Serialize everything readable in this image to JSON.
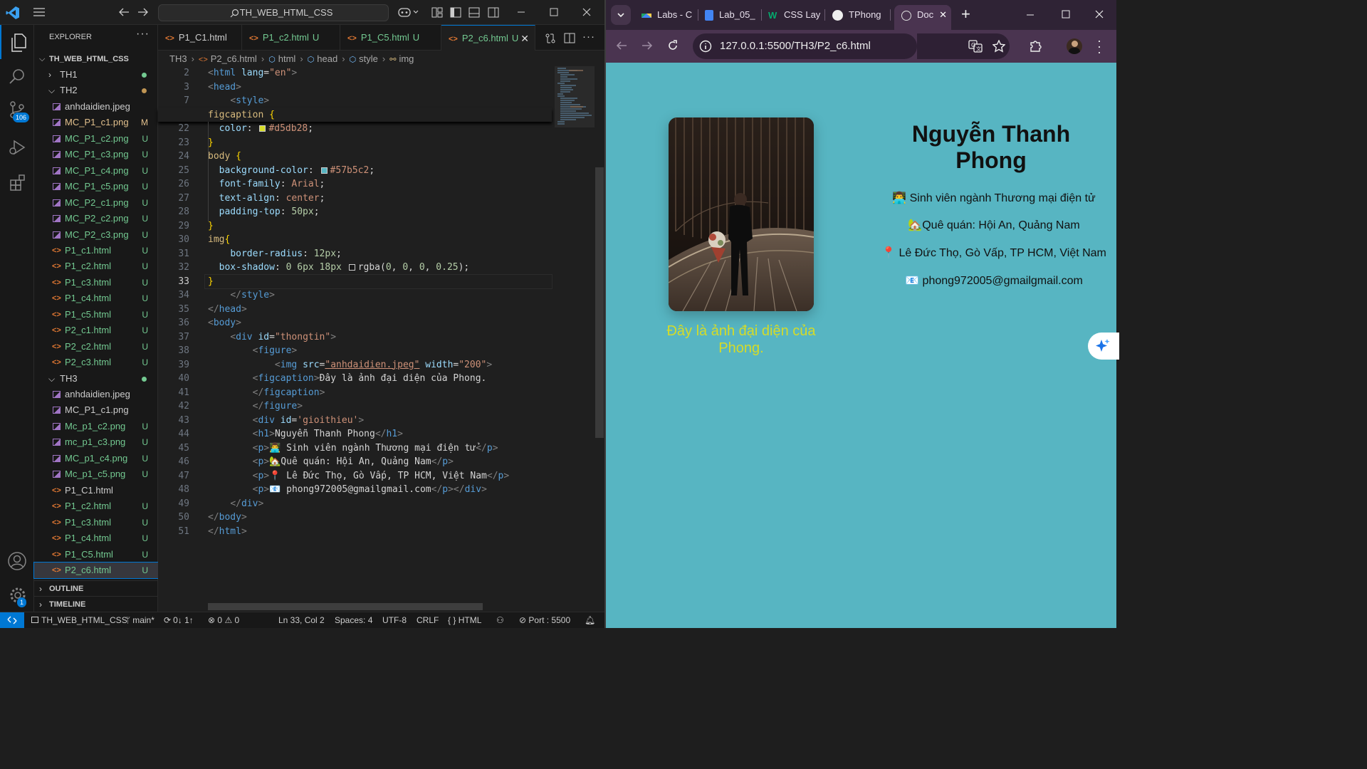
{
  "vscode": {
    "command_center": "TH_WEB_HTML_CSS",
    "scm_badge": "106",
    "settings_badge": "1",
    "explorer": {
      "title": "EXPLORER",
      "root": "TH_WEB_HTML_CSS",
      "items": [
        {
          "label": "TH1",
          "kind": "folder",
          "status": "",
          "dot": "#73c991",
          "open": false
        },
        {
          "label": "TH2",
          "kind": "folder",
          "status": "",
          "dot": "#c09553",
          "open": true
        },
        {
          "label": "anhdaidien.jpeg",
          "kind": "image",
          "status": ""
        },
        {
          "label": "MC_P1_c1.png",
          "kind": "image",
          "status": "M"
        },
        {
          "label": "MC_P1_c2.png",
          "kind": "image",
          "status": "U"
        },
        {
          "label": "MC_P1_c3.png",
          "kind": "image",
          "status": "U"
        },
        {
          "label": "MC_P1_c4.png",
          "kind": "image",
          "status": "U"
        },
        {
          "label": "MC_P1_c5.png",
          "kind": "image",
          "status": "U"
        },
        {
          "label": "MC_P2_c1.png",
          "kind": "image",
          "status": "U"
        },
        {
          "label": "MC_P2_c2.png",
          "kind": "image",
          "status": "U"
        },
        {
          "label": "MC_P2_c3.png",
          "kind": "image",
          "status": "U"
        },
        {
          "label": "P1_c1.html",
          "kind": "html",
          "status": "U"
        },
        {
          "label": "P1_c2.html",
          "kind": "html",
          "status": "U"
        },
        {
          "label": "P1_c3.html",
          "kind": "html",
          "status": "U"
        },
        {
          "label": "P1_c4.html",
          "kind": "html",
          "status": "U"
        },
        {
          "label": "P1_c5.html",
          "kind": "html",
          "status": "U"
        },
        {
          "label": "P2_c1.html",
          "kind": "html",
          "status": "U"
        },
        {
          "label": "P2_c2.html",
          "kind": "html",
          "status": "U"
        },
        {
          "label": "P2_c3.html",
          "kind": "html",
          "status": "U"
        },
        {
          "label": "TH3",
          "kind": "folder",
          "status": "",
          "dot": "#73c991",
          "open": true
        },
        {
          "label": "anhdaidien.jpeg",
          "kind": "image",
          "status": ""
        },
        {
          "label": "MC_P1_c1.png",
          "kind": "image",
          "status": ""
        },
        {
          "label": "Mc_p1_c2.png",
          "kind": "image",
          "status": "U"
        },
        {
          "label": "mc_p1_c3.png",
          "kind": "image",
          "status": "U"
        },
        {
          "label": "MC_p1_c4.png",
          "kind": "image",
          "status": "U"
        },
        {
          "label": "Mc_p1_c5.png",
          "kind": "image",
          "status": "U"
        },
        {
          "label": "P1_C1.html",
          "kind": "html",
          "status": ""
        },
        {
          "label": "P1_c2.html",
          "kind": "html",
          "status": "U"
        },
        {
          "label": "P1_c3.html",
          "kind": "html",
          "status": "U"
        },
        {
          "label": "P1_c4.html",
          "kind": "html",
          "status": "U"
        },
        {
          "label": "P1_C5.html",
          "kind": "html",
          "status": "U"
        },
        {
          "label": "P2_c6.html",
          "kind": "html",
          "status": "U",
          "selected": true
        }
      ],
      "outline": "OUTLINE",
      "timeline": "TIMELINE"
    },
    "tabs": [
      {
        "label": "P1_C1.html",
        "status": "",
        "active": false
      },
      {
        "label": "P1_c2.html",
        "status": "U",
        "active": false
      },
      {
        "label": "P1_C5.html",
        "status": "U",
        "active": false
      },
      {
        "label": "P2_c6.html",
        "status": "U",
        "active": true
      }
    ],
    "breadcrumb": [
      "TH3",
      "P2_c6.html",
      "html",
      "head",
      "style",
      "img"
    ],
    "code_lines": [
      {
        "n": "2",
        "t": [
          [
            "tg",
            "<"
          ],
          [
            "tn",
            "html"
          ],
          [
            "txt",
            " "
          ],
          [
            "at",
            "lang"
          ],
          [
            "txt",
            "="
          ],
          [
            "sv",
            "\"en\""
          ],
          [
            "tg",
            ">"
          ]
        ]
      },
      {
        "n": "3",
        "t": [
          [
            "tg",
            "<"
          ],
          [
            "tn",
            "head"
          ],
          [
            "tg",
            ">"
          ]
        ]
      },
      {
        "n": "7",
        "t": [
          [
            "txt",
            "    "
          ],
          [
            "tg",
            "<"
          ],
          [
            "tn",
            "style"
          ],
          [
            "tg",
            ">"
          ]
        ]
      },
      {
        "n": "19",
        "t": [
          [
            "sel",
            "figcaption"
          ],
          [
            "txt",
            " "
          ],
          [
            "br",
            "{"
          ]
        ],
        "sticky": true
      },
      {
        "n": "22",
        "t": [
          [
            "txt",
            "  "
          ],
          [
            "pr",
            "color"
          ],
          [
            "txt",
            ": "
          ],
          [
            "sw",
            "#d5db28"
          ],
          [
            "pv",
            "#d5db28"
          ],
          [
            "txt",
            ";"
          ]
        ]
      },
      {
        "n": "23",
        "t": [
          [
            "br",
            "}"
          ]
        ]
      },
      {
        "n": "24",
        "t": [
          [
            "sel",
            "body"
          ],
          [
            "txt",
            " "
          ],
          [
            "br",
            "{"
          ]
        ]
      },
      {
        "n": "25",
        "t": [
          [
            "txt",
            "  "
          ],
          [
            "pr",
            "background-color"
          ],
          [
            "txt",
            ": "
          ],
          [
            "sw",
            "#57b5c2"
          ],
          [
            "pv",
            "#57b5c2"
          ],
          [
            "txt",
            ";"
          ]
        ]
      },
      {
        "n": "26",
        "t": [
          [
            "txt",
            "  "
          ],
          [
            "pr",
            "font-family"
          ],
          [
            "txt",
            ": "
          ],
          [
            "pv",
            "Arial"
          ],
          [
            "txt",
            ";"
          ]
        ]
      },
      {
        "n": "27",
        "t": [
          [
            "txt",
            "  "
          ],
          [
            "pr",
            "text-align"
          ],
          [
            "txt",
            ": "
          ],
          [
            "pv",
            "center"
          ],
          [
            "txt",
            ";"
          ]
        ]
      },
      {
        "n": "28",
        "t": [
          [
            "txt",
            "  "
          ],
          [
            "pr",
            "padding-top"
          ],
          [
            "txt",
            ": "
          ],
          [
            "nm",
            "50px"
          ],
          [
            "txt",
            ";"
          ]
        ]
      },
      {
        "n": "29",
        "t": [
          [
            "br",
            "}"
          ]
        ]
      },
      {
        "n": "30",
        "t": [
          [
            "sel",
            "img"
          ],
          [
            "br",
            "{"
          ]
        ]
      },
      {
        "n": "31",
        "t": [
          [
            "txt",
            "    "
          ],
          [
            "pr",
            "border-radius"
          ],
          [
            "txt",
            ": "
          ],
          [
            "nm",
            "12px"
          ],
          [
            "txt",
            ";"
          ]
        ]
      },
      {
        "n": "32",
        "t": [
          [
            "txt",
            "  "
          ],
          [
            "pr",
            "box-shadow"
          ],
          [
            "txt",
            ": "
          ],
          [
            "nm",
            "0 6px 18px"
          ],
          [
            "txt",
            " "
          ],
          [
            "sw",
            "rgba(0,0,0,0.25)"
          ],
          [
            "txt",
            "rgba("
          ],
          [
            "nm",
            "0"
          ],
          [
            "txt",
            ", "
          ],
          [
            "nm",
            "0"
          ],
          [
            "txt",
            ", "
          ],
          [
            "nm",
            "0"
          ],
          [
            "txt",
            ", "
          ],
          [
            "nm",
            "0.25"
          ],
          [
            "txt",
            ");"
          ]
        ]
      },
      {
        "n": "33",
        "t": [
          [
            "br",
            "}"
          ]
        ],
        "current": true
      },
      {
        "n": "34",
        "t": [
          [
            "txt",
            "    "
          ],
          [
            "tg",
            "</"
          ],
          [
            "tn",
            "style"
          ],
          [
            "tg",
            ">"
          ]
        ]
      },
      {
        "n": "35",
        "t": [
          [
            "tg",
            "</"
          ],
          [
            "tn",
            "head"
          ],
          [
            "tg",
            ">"
          ]
        ]
      },
      {
        "n": "36",
        "t": [
          [
            "tg",
            "<"
          ],
          [
            "tn",
            "body"
          ],
          [
            "tg",
            ">"
          ]
        ]
      },
      {
        "n": "37",
        "t": [
          [
            "txt",
            "    "
          ],
          [
            "tg",
            "<"
          ],
          [
            "tn",
            "div"
          ],
          [
            "txt",
            " "
          ],
          [
            "at",
            "id"
          ],
          [
            "txt",
            "="
          ],
          [
            "sv",
            "\"thongtin\""
          ],
          [
            "tg",
            ">"
          ]
        ]
      },
      {
        "n": "38",
        "t": [
          [
            "txt",
            "        "
          ],
          [
            "tg",
            "<"
          ],
          [
            "tn",
            "figure"
          ],
          [
            "tg",
            ">"
          ]
        ]
      },
      {
        "n": "39",
        "t": [
          [
            "txt",
            "            "
          ],
          [
            "tg",
            "<"
          ],
          [
            "tn",
            "img"
          ],
          [
            "txt",
            " "
          ],
          [
            "at",
            "src"
          ],
          [
            "txt",
            "="
          ],
          [
            "svu",
            "\"anhdaidien.jpeg\""
          ],
          [
            "txt",
            " "
          ],
          [
            "at",
            "width"
          ],
          [
            "txt",
            "="
          ],
          [
            "sv",
            "\"200\""
          ],
          [
            "tg",
            ">"
          ]
        ]
      },
      {
        "n": "40",
        "t": [
          [
            "txt",
            "        "
          ],
          [
            "tg",
            "<"
          ],
          [
            "tn",
            "figcaption"
          ],
          [
            "tg",
            ">"
          ],
          [
            "txt",
            "Đây là ảnh đại diện của Phong."
          ]
        ]
      },
      {
        "n": "41",
        "t": [
          [
            "txt",
            "        "
          ],
          [
            "tg",
            "</"
          ],
          [
            "tn",
            "figcaption"
          ],
          [
            "tg",
            ">"
          ]
        ]
      },
      {
        "n": "42",
        "t": [
          [
            "txt",
            "        "
          ],
          [
            "tg",
            "</"
          ],
          [
            "tn",
            "figure"
          ],
          [
            "tg",
            ">"
          ]
        ]
      },
      {
        "n": "43",
        "t": [
          [
            "txt",
            "        "
          ],
          [
            "tg",
            "<"
          ],
          [
            "tn",
            "div"
          ],
          [
            "txt",
            " "
          ],
          [
            "at",
            "id"
          ],
          [
            "txt",
            "="
          ],
          [
            "sv",
            "'gioithieu'"
          ],
          [
            "tg",
            ">"
          ]
        ]
      },
      {
        "n": "44",
        "t": [
          [
            "txt",
            "        "
          ],
          [
            "tg",
            "<"
          ],
          [
            "tn",
            "h1"
          ],
          [
            "tg",
            ">"
          ],
          [
            "txt",
            "Nguyễn Thanh Phong"
          ],
          [
            "tg",
            "</"
          ],
          [
            "tn",
            "h1"
          ],
          [
            "tg",
            ">"
          ]
        ]
      },
      {
        "n": "45",
        "t": [
          [
            "txt",
            "        "
          ],
          [
            "tg",
            "<"
          ],
          [
            "tn",
            "p"
          ],
          [
            "tg",
            ">"
          ],
          [
            "txt",
            "👨‍💻 Sinh viên ngành Thương mại điện tử"
          ],
          [
            "tg",
            "</"
          ],
          [
            "tn",
            "p"
          ],
          [
            "tg",
            ">"
          ]
        ]
      },
      {
        "n": "46",
        "t": [
          [
            "txt",
            "        "
          ],
          [
            "tg",
            "<"
          ],
          [
            "tn",
            "p"
          ],
          [
            "tg",
            ">"
          ],
          [
            "txt",
            "🏡Quê quán: Hội An, Quảng Nam"
          ],
          [
            "tg",
            "</"
          ],
          [
            "tn",
            "p"
          ],
          [
            "tg",
            ">"
          ]
        ]
      },
      {
        "n": "47",
        "t": [
          [
            "txt",
            "        "
          ],
          [
            "tg",
            "<"
          ],
          [
            "tn",
            "p"
          ],
          [
            "tg",
            ">"
          ],
          [
            "txt",
            "📍 Lê Đức Thọ, Gò Vấp, TP HCM, Việt Nam"
          ],
          [
            "tg",
            "</"
          ],
          [
            "tn",
            "p"
          ],
          [
            "tg",
            ">"
          ]
        ]
      },
      {
        "n": "48",
        "t": [
          [
            "txt",
            "        "
          ],
          [
            "tg",
            "<"
          ],
          [
            "tn",
            "p"
          ],
          [
            "tg",
            ">"
          ],
          [
            "txt",
            "📧 phong972005@gmailgmail.com"
          ],
          [
            "tg",
            "</"
          ],
          [
            "tn",
            "p"
          ],
          [
            "tg",
            "></"
          ],
          [
            "tn",
            "div"
          ],
          [
            "tg",
            ">"
          ]
        ]
      },
      {
        "n": "49",
        "t": [
          [
            "txt",
            "    "
          ],
          [
            "tg",
            "</"
          ],
          [
            "tn",
            "div"
          ],
          [
            "tg",
            ">"
          ]
        ]
      },
      {
        "n": "50",
        "t": [
          [
            "tg",
            "</"
          ],
          [
            "tn",
            "body"
          ],
          [
            "tg",
            ">"
          ]
        ]
      },
      {
        "n": "51",
        "t": [
          [
            "tg",
            "</"
          ],
          [
            "tn",
            "html"
          ],
          [
            "tg",
            ">"
          ]
        ]
      }
    ],
    "status": {
      "folder": "TH_WEB_HTML_CSS",
      "branch": "main*",
      "sync": "0↓ 1↑",
      "problems": "0",
      "warnings": "0",
      "position": "Ln 33, Col 2",
      "spaces": "Spaces: 4",
      "encoding": "UTF-8",
      "eol": "CRLF",
      "language": "HTML",
      "port": "Port : 5500"
    }
  },
  "chrome": {
    "tabs": [
      {
        "label": "Labs - C",
        "icon": "drive-icon"
      },
      {
        "label": "Lab_05_",
        "icon": "docs-icon"
      },
      {
        "label": "CSS Lay",
        "icon": "w3-icon"
      },
      {
        "label": "TPhong",
        "icon": "github-icon"
      },
      {
        "label": "Doc",
        "icon": "globe-icon",
        "active": true
      }
    ],
    "url": "127.0.0.1:5500/TH3/P2_c6.html",
    "page": {
      "caption": "Đây là ảnh đại diện của Phong.",
      "heading": "Nguyễn Thanh Phong",
      "lines": [
        "👨‍💻 Sinh viên ngành Thương mại điện tử",
        "🏡Quê quán: Hội An, Quảng Nam",
        "📍 Lê Đức Thọ, Gò Vấp, TP HCM, Việt Nam",
        "📧 phong972005@gmailgmail.com"
      ],
      "bg": "#57b5c2",
      "caption_color": "#d5db28"
    }
  }
}
